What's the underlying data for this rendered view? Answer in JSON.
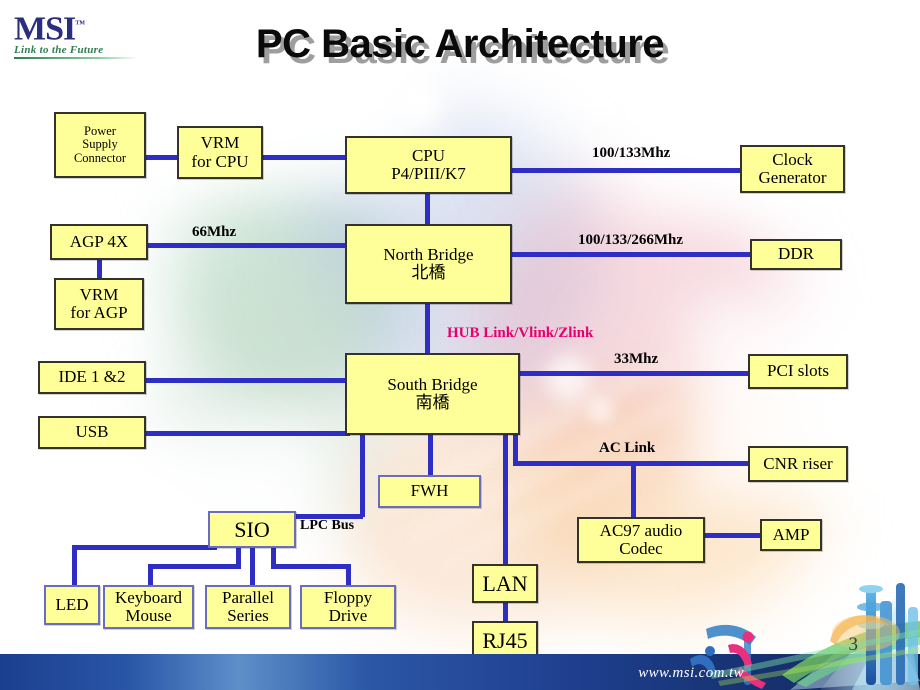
{
  "brand": {
    "logo_text": "MSI",
    "logo_tm": "™",
    "tagline": "Link to the Future"
  },
  "title": "PC Basic Architecture",
  "footer": {
    "url": "www.msi.com.tw",
    "page_number": "3"
  },
  "colors": {
    "node_fill": "#FFFF99",
    "node_border": "#33332A",
    "wire": "#2E2EC4",
    "hub_label": "#E5006E",
    "logo_navy": "#2B2D7E",
    "logo_green": "#2E7D4F",
    "footer_blue": "#1B3F8F"
  },
  "chart_data": {
    "type": "diagram",
    "title": "PC Basic Architecture",
    "nodes": [
      {
        "id": "psu",
        "label": "Power\nSupply\nConnector",
        "lines": [
          "Power",
          "Supply",
          "Connector"
        ]
      },
      {
        "id": "vrm_cpu",
        "label": "VRM\nfor CPU",
        "lines": [
          "VRM",
          "for CPU"
        ]
      },
      {
        "id": "cpu",
        "label": "CPU\nP4/PIII/K7",
        "lines": [
          "CPU",
          "P4/PIII/K7"
        ]
      },
      {
        "id": "clock_gen",
        "label": "Clock\nGenerator",
        "lines": [
          "Clock",
          "Generator"
        ]
      },
      {
        "id": "agp",
        "label": "AGP 4X",
        "lines": [
          "AGP 4X"
        ]
      },
      {
        "id": "vrm_agp",
        "label": "VRM\nfor AGP",
        "lines": [
          "VRM",
          "for AGP"
        ]
      },
      {
        "id": "north",
        "label": "North Bridge\n北橋",
        "lines": [
          "North Bridge",
          "北橋"
        ]
      },
      {
        "id": "ddr",
        "label": "DDR",
        "lines": [
          "DDR"
        ]
      },
      {
        "id": "ide",
        "label": "IDE 1 &2",
        "lines": [
          "IDE 1 &2"
        ]
      },
      {
        "id": "usb",
        "label": "USB",
        "lines": [
          "USB"
        ]
      },
      {
        "id": "south",
        "label": "South Bridge\n南橋",
        "lines": [
          "South Bridge",
          "南橋"
        ]
      },
      {
        "id": "pci",
        "label": "PCI slots",
        "lines": [
          "PCI slots"
        ]
      },
      {
        "id": "cnr",
        "label": "CNR riser",
        "lines": [
          "CNR riser"
        ]
      },
      {
        "id": "fwh",
        "label": "FWH",
        "lines": [
          "FWH"
        ]
      },
      {
        "id": "sio",
        "label": "SIO",
        "lines": [
          "SIO"
        ]
      },
      {
        "id": "ac97",
        "label": "AC97 audio\nCodec",
        "lines": [
          "AC97 audio",
          "Codec"
        ]
      },
      {
        "id": "amp",
        "label": "AMP",
        "lines": [
          "AMP"
        ]
      },
      {
        "id": "led",
        "label": "LED",
        "lines": [
          "LED"
        ]
      },
      {
        "id": "keyboard",
        "label": "Keyboard\nMouse",
        "lines": [
          "Keyboard",
          "Mouse"
        ]
      },
      {
        "id": "parallel",
        "label": "Parallel\nSeries",
        "lines": [
          "Parallel",
          "Series"
        ]
      },
      {
        "id": "floppy",
        "label": "Floppy\nDrive",
        "lines": [
          "Floppy",
          "Drive"
        ]
      },
      {
        "id": "lan",
        "label": "LAN",
        "lines": [
          "LAN"
        ]
      },
      {
        "id": "rj45",
        "label": "RJ45",
        "lines": [
          "RJ45"
        ]
      }
    ],
    "edge_labels": [
      {
        "id": "cpu_clock",
        "text": "100/133Mhz",
        "between": [
          "cpu",
          "clock_gen"
        ]
      },
      {
        "id": "agp_north",
        "text": "66Mhz",
        "between": [
          "agp",
          "north"
        ]
      },
      {
        "id": "north_ddr",
        "text": "100/133/266Mhz",
        "between": [
          "north",
          "ddr"
        ]
      },
      {
        "id": "hublink",
        "text": "HUB Link/Vlink/Zlink",
        "between": [
          "north",
          "south"
        ],
        "color": "#E5006E"
      },
      {
        "id": "south_pci",
        "text": "33Mhz",
        "between": [
          "south",
          "pci"
        ]
      },
      {
        "id": "ac_link",
        "text": "AC Link",
        "between": [
          "south",
          "cnr"
        ]
      },
      {
        "id": "lpc_bus",
        "text": "LPC Bus",
        "between": [
          "south",
          "sio"
        ]
      }
    ],
    "edges": [
      [
        "psu",
        "vrm_cpu"
      ],
      [
        "vrm_cpu",
        "cpu"
      ],
      [
        "cpu",
        "clock_gen"
      ],
      [
        "cpu",
        "north"
      ],
      [
        "agp",
        "north"
      ],
      [
        "agp",
        "vrm_agp"
      ],
      [
        "north",
        "ddr"
      ],
      [
        "north",
        "south"
      ],
      [
        "ide",
        "south"
      ],
      [
        "usb",
        "south"
      ],
      [
        "south",
        "pci"
      ],
      [
        "south",
        "cnr"
      ],
      [
        "south",
        "fwh"
      ],
      [
        "south",
        "sio"
      ],
      [
        "south",
        "lan"
      ],
      [
        "south",
        "ac97"
      ],
      [
        "ac97",
        "amp"
      ],
      [
        "lan",
        "rj45"
      ],
      [
        "sio",
        "led"
      ],
      [
        "sio",
        "keyboard"
      ],
      [
        "sio",
        "parallel"
      ],
      [
        "sio",
        "floppy"
      ]
    ]
  }
}
